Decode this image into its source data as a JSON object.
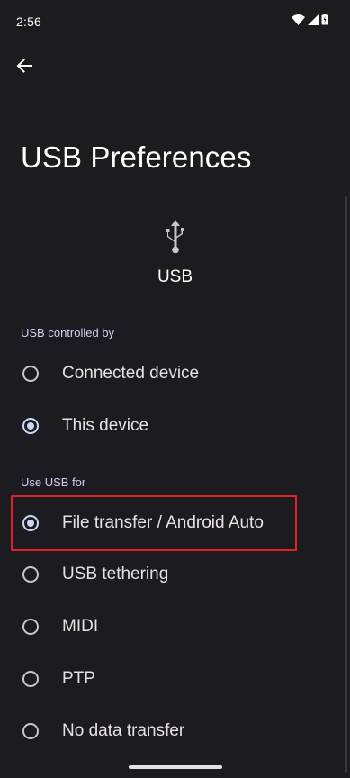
{
  "status_bar": {
    "time": "2:56",
    "icons": [
      "wifi-icon",
      "signal-icon",
      "battery-icon"
    ]
  },
  "header": {
    "back_icon": "arrow-back-icon",
    "title": "USB Preferences"
  },
  "usb_summary": {
    "icon": "usb-icon",
    "label": "USB"
  },
  "controlled_by": {
    "header": "USB controlled by",
    "options": [
      {
        "label": "Connected device",
        "selected": false
      },
      {
        "label": "This device",
        "selected": true
      }
    ]
  },
  "use_usb_for": {
    "header": "Use USB for",
    "options": [
      {
        "label": "File transfer / Android Auto",
        "selected": true,
        "highlighted": true
      },
      {
        "label": "USB tethering",
        "selected": false
      },
      {
        "label": "MIDI",
        "selected": false
      },
      {
        "label": "PTP",
        "selected": false
      },
      {
        "label": "No data transfer",
        "selected": false
      }
    ]
  },
  "colors": {
    "background": "#1c1b1f",
    "accent": "#d0d4f7",
    "highlight": "#e0202a"
  }
}
